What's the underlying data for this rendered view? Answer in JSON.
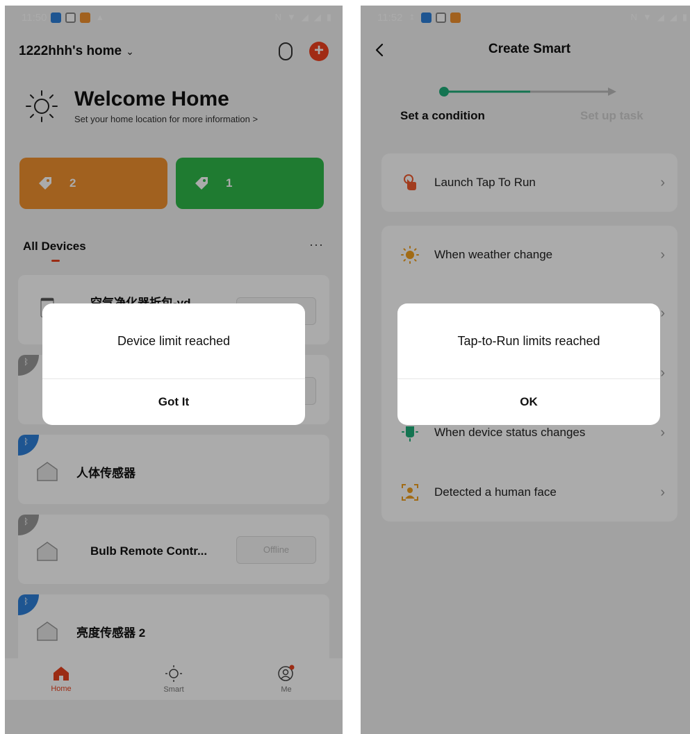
{
  "left": {
    "status": {
      "time": "11:50"
    },
    "header": {
      "home_name": "1222hhh's home"
    },
    "welcome": {
      "title": "Welcome Home",
      "subtitle": "Set your home location for more information >"
    },
    "tags": [
      {
        "count": "2",
        "color": "#f0912f"
      },
      {
        "count": "1",
        "color": "#2fb84a"
      }
    ],
    "section": {
      "title": "All Devices",
      "more": "···"
    },
    "devices": [
      {
        "name": "空气净化器折包-yd"
      },
      {
        "name": ""
      },
      {
        "name": "人体传感器"
      },
      {
        "name": "Bulb Remote Contr...",
        "status": "Offline"
      },
      {
        "name": "亮度传感器 2"
      }
    ],
    "tabs": [
      {
        "label": "Home"
      },
      {
        "label": "Smart"
      },
      {
        "label": "Me"
      }
    ],
    "dialog": {
      "message": "Device limit reached",
      "button": "Got It"
    }
  },
  "right": {
    "status": {
      "time": "11:52"
    },
    "title": "Create Smart",
    "steps": [
      "Set a condition",
      "Set up task"
    ],
    "conditions": [
      {
        "label": "Launch Tap To Run",
        "icon": "tap-hand-icon"
      },
      {
        "label": "When weather change",
        "icon": "sun-icon"
      },
      {
        "label": "When device status changes",
        "icon": "device-status-icon"
      },
      {
        "label": "Detected a human face",
        "icon": "face-detect-icon"
      }
    ],
    "dialog": {
      "message": "Tap-to-Run limits reached",
      "button": "OK"
    }
  },
  "colors": {
    "accent": "#e8421e",
    "progress": "#1fae7a",
    "orange": "#f0912f",
    "green": "#2fb84a",
    "bluetooth": "#2d7fd8"
  }
}
